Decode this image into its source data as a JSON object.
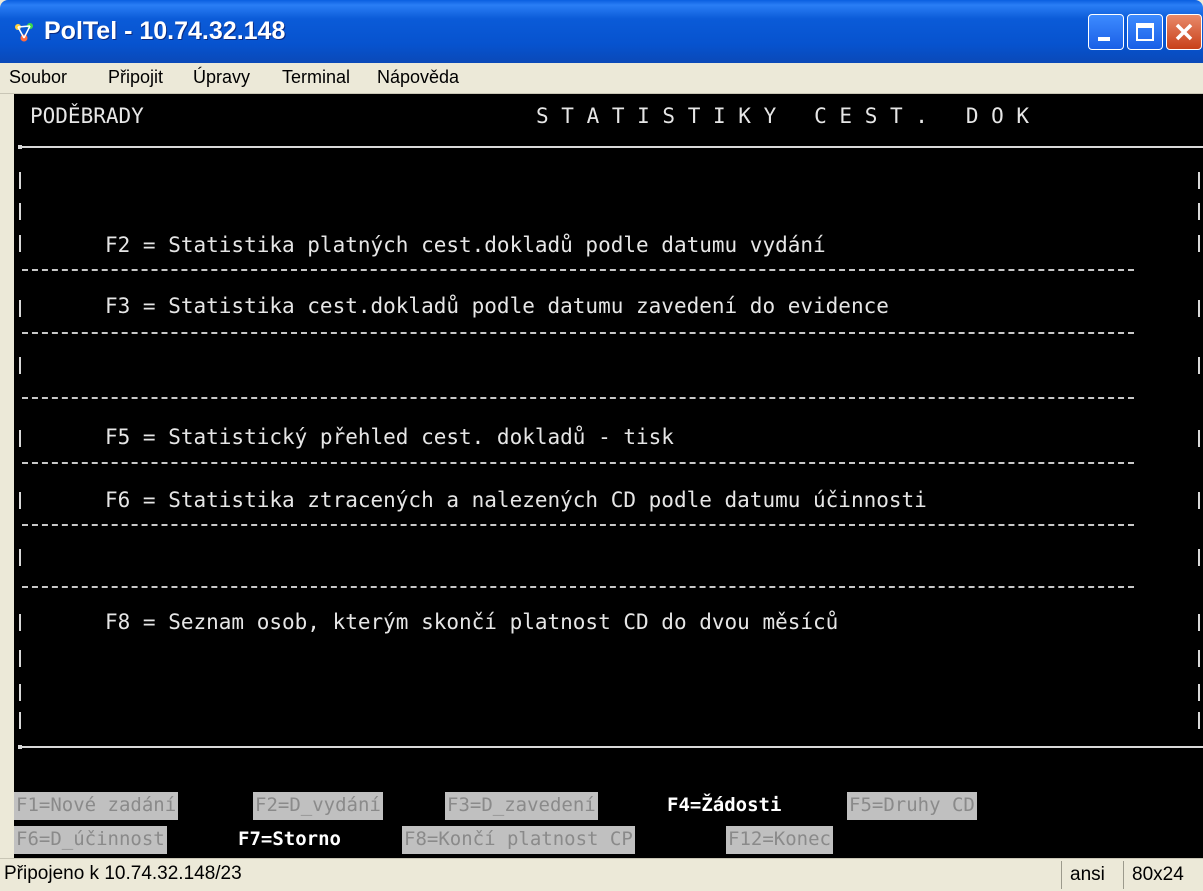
{
  "window": {
    "title": "PolTel - 10.74.32.148"
  },
  "menu": [
    "Soubor",
    "Připojit",
    "Úpravy",
    "Terminal",
    "Nápověda"
  ],
  "terminal": {
    "location": "PODĚBRADY",
    "heading": "S T A T I S T I K Y   C E S T .   D O K",
    "options": [
      {
        "text": "F2 = Statistika platných cest.dokladů podle datumu vydání"
      },
      {
        "text": "F3 = Statistika cest.dokladů podle datumu zavedení do evidence"
      },
      {
        "text": "F5 = Statistický přehled cest. dokladů - tisk"
      },
      {
        "text": "F6 = Statistika ztracených a nalezených CD podle datumu účinnosti"
      },
      {
        "text": "F8 = Seznam osob, kterým skončí platnost CD do dvou měsíců"
      }
    ],
    "fkeys_row1": [
      {
        "label": "F1=Nové zadání",
        "style": "gray"
      },
      {
        "label": "F2=D_vydání",
        "style": "gray"
      },
      {
        "label": "F3=D_zavedení",
        "style": "gray"
      },
      {
        "label": "F4=Žádosti",
        "style": "bright"
      },
      {
        "label": "F5=Druhy CD",
        "style": "gray"
      }
    ],
    "fkeys_row2": [
      {
        "label": "F6=D_účinnost",
        "style": "gray"
      },
      {
        "label": "F7=Storno",
        "style": "bright"
      },
      {
        "label": "F8=Končí platnost CP",
        "style": "gray"
      },
      {
        "label": "F12=Konec",
        "style": "gray"
      }
    ]
  },
  "status": {
    "connection": "Připojeno k 10.74.32.148/23",
    "encoding": "ansi",
    "size": "80x24"
  },
  "colors": {
    "titlebar": "#0753cf",
    "terminal_bg": "#000000",
    "terminal_fg": "#e6e6e6",
    "fkey_gray_bg": "#c0c0c0"
  }
}
